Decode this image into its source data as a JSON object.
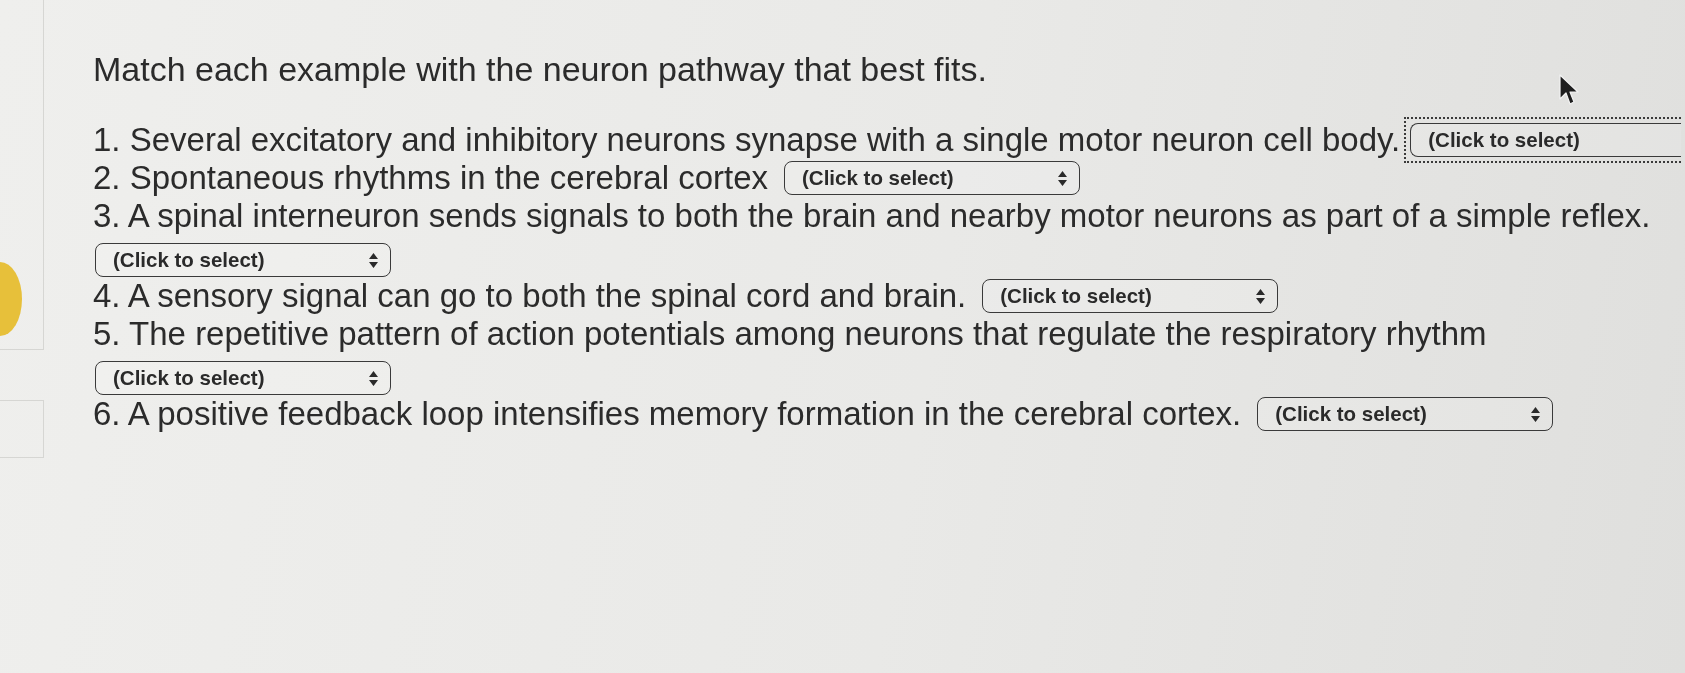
{
  "title": "Match each example with the neuron pathway that best fits.",
  "items": [
    {
      "text": "1. Several excitatory and inhibitory neurons synapse with a single motor neuron cell body.",
      "dropdown": {
        "value": "(Click to select)",
        "focused": true
      }
    },
    {
      "text": "2. Spontaneous rhythms in the cerebral cortex",
      "dropdown": {
        "value": "(Click to select)",
        "focused": false
      }
    },
    {
      "text": "3. A spinal interneuron sends signals to both the brain and nearby motor neurons as part of a simple reflex.",
      "dropdown": {
        "value": "(Click to select)",
        "focused": false
      }
    },
    {
      "text": "4. A sensory signal can go to both the spinal cord and brain.",
      "dropdown": {
        "value": "(Click to select)",
        "focused": false
      }
    },
    {
      "text": "5. The repetitive pattern of action potentials among neurons that regulate the respiratory rhythm",
      "dropdown": {
        "value": "(Click to select)",
        "focused": false
      }
    },
    {
      "text": "6. A positive feedback loop intensifies memory formation in the cerebral cortex.",
      "dropdown": {
        "value": "(Click to select)",
        "focused": false
      }
    }
  ]
}
